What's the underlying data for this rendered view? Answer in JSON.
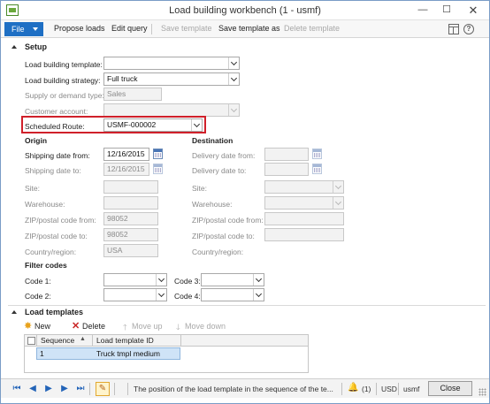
{
  "window": {
    "title": "Load building workbench (1 - usmf)",
    "minimize_glyph": "—",
    "maximize_glyph": "☐",
    "close_glyph": "✕"
  },
  "actionbar": {
    "file_label": "File",
    "propose_loads": "Propose loads",
    "edit_query": "Edit query",
    "save_template": "Save template",
    "save_template_as": "Save template as",
    "delete_template": "Delete template",
    "help_glyph": "?"
  },
  "setup": {
    "header": "Setup",
    "load_building_template": {
      "label": "Load building template:",
      "value": ""
    },
    "load_building_strategy": {
      "label": "Load building strategy:",
      "value": "Full truck"
    },
    "supply_or_demand_type": {
      "label": "Supply or demand type:",
      "value": "Sales"
    },
    "customer_account": {
      "label": "Customer account:",
      "value": ""
    },
    "scheduled_route": {
      "label": "Scheduled Route:",
      "value": "USMF-000002"
    },
    "origin": {
      "header": "Origin",
      "shipping_date_from": {
        "label": "Shipping date from:",
        "value": "12/16/2015"
      },
      "shipping_date_to": {
        "label": "Shipping date to:",
        "value": "12/16/2015"
      },
      "site": {
        "label": "Site:",
        "value": ""
      },
      "warehouse": {
        "label": "Warehouse:",
        "value": ""
      },
      "zip_from": {
        "label": "ZIP/postal code from:",
        "value": "98052"
      },
      "zip_to": {
        "label": "ZIP/postal code to:",
        "value": "98052"
      },
      "country_region": {
        "label": "Country/region:",
        "value": "USA"
      }
    },
    "destination": {
      "header": "Destination",
      "delivery_date_from": {
        "label": "Delivery date from:",
        "value": ""
      },
      "delivery_date_to": {
        "label": "Delivery date to:",
        "value": ""
      },
      "site": {
        "label": "Site:",
        "value": ""
      },
      "warehouse": {
        "label": "Warehouse:",
        "value": ""
      },
      "zip_from": {
        "label": "ZIP/postal code from:",
        "value": ""
      },
      "zip_to": {
        "label": "ZIP/postal code to:",
        "value": ""
      },
      "country_region": {
        "label": "Country/region:",
        "value": ""
      }
    },
    "filter_codes": {
      "header": "Filter codes",
      "code1": {
        "label": "Code 1:",
        "value": ""
      },
      "code2": {
        "label": "Code 2:",
        "value": ""
      },
      "code3": {
        "label": "Code 3:",
        "value": ""
      },
      "code4": {
        "label": "Code 4:",
        "value": ""
      }
    }
  },
  "load_templates": {
    "header": "Load templates",
    "toolbar": {
      "new": "New",
      "delete": "Delete",
      "move_up": "Move up",
      "move_down": "Move down"
    },
    "columns": [
      "Sequence",
      "Load template ID"
    ],
    "rows": [
      {
        "sequence": "1",
        "load_template_id": "Truck tmpl medium"
      }
    ]
  },
  "statusbar": {
    "help_text": "The position of the load template in the sequence of the te...",
    "currency": "USD",
    "company": "usmf",
    "close_label": "Close"
  },
  "colors": {
    "accent": "#1e6fc4",
    "highlight_border": "#d0202a",
    "selected_row": "#cfe3f7"
  }
}
